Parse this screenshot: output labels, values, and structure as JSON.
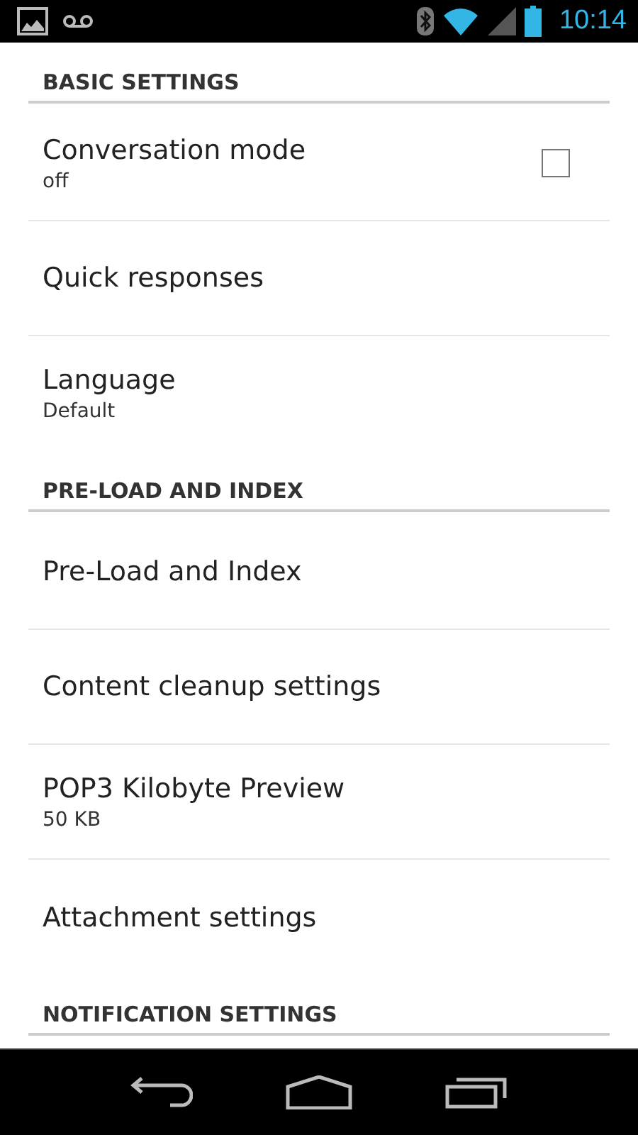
{
  "status_bar": {
    "time": "10:14"
  },
  "sections": [
    {
      "title": "BASIC SETTINGS",
      "items": [
        {
          "kind": "checkbox",
          "title": "Conversation mode",
          "summary": "off",
          "checked": false
        },
        {
          "kind": "plain",
          "title": "Quick responses"
        },
        {
          "kind": "plain",
          "title": "Language",
          "summary": "Default"
        }
      ]
    },
    {
      "title": "PRE-LOAD AND INDEX",
      "items": [
        {
          "kind": "plain",
          "title": "Pre-Load and Index"
        },
        {
          "kind": "plain",
          "title": "Content cleanup settings"
        },
        {
          "kind": "plain",
          "title": "POP3 Kilobyte Preview",
          "summary": "50 KB"
        },
        {
          "kind": "plain",
          "title": "Attachment settings"
        }
      ]
    },
    {
      "title": "NOTIFICATION SETTINGS"
    }
  ]
}
